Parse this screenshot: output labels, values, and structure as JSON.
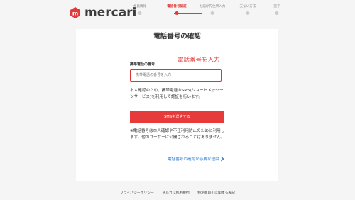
{
  "brand": {
    "name": "mercari",
    "accent": "#e03a3a",
    "link_color": "#2a7ad6"
  },
  "steps": [
    {
      "label": "会員情報",
      "active": false
    },
    {
      "label": "電話番号認証",
      "active": true
    },
    {
      "label": "お届け先住所入力",
      "active": false
    },
    {
      "label": "支払い方法",
      "active": false
    },
    {
      "label": "完了",
      "active": false
    }
  ],
  "page": {
    "title": "電話番号の確認",
    "annotation": "電話番号を入力",
    "field_label": "携帯電話の番号",
    "input": {
      "value": "",
      "placeholder": "携帯電話の番号を入力"
    },
    "description": "本人確認のため、携帯電話のSMS(ショートメッセージサービス)を利用して認証を行います。",
    "submit_label": "SMSを送信する",
    "notice": "※電話番号は本人確認や不正利用防止のために利用します。他のユーザーに公開されることはありません。",
    "help_link": "電話番号の確認が必要な理由"
  },
  "footer": {
    "links": [
      "プライバシーポリシー",
      "メルカリ利用規約",
      "特定商取引に関する表記"
    ]
  }
}
